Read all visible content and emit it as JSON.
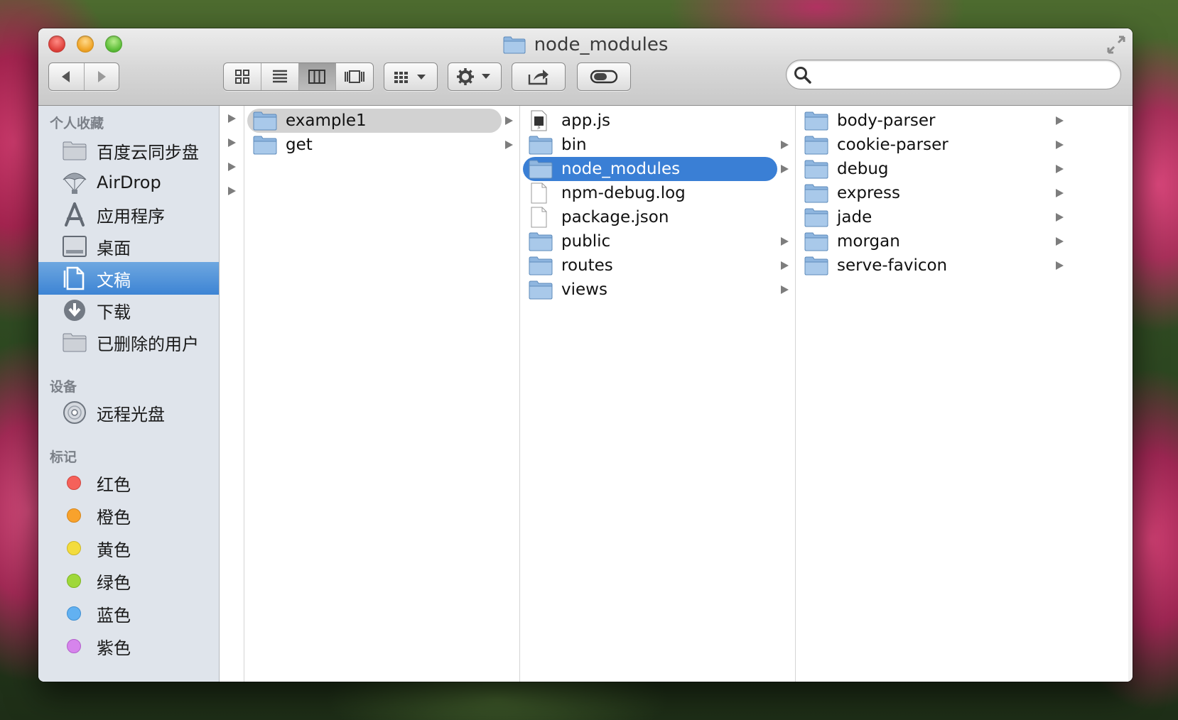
{
  "window": {
    "title": "node_modules"
  },
  "toolbar": {
    "nav": {
      "back": "back-arrow",
      "forward": "forward-arrow"
    },
    "view_modes": [
      "icon-view",
      "list-view",
      "column-view",
      "cover-flow-view"
    ],
    "active_view": "column-view",
    "arrange": "arrange-grid",
    "action": "gear",
    "share": "share",
    "tags": "toggle",
    "search": {
      "value": "",
      "placeholder": ""
    }
  },
  "sidebar": {
    "favorites_header": "个人收藏",
    "favorites": [
      {
        "label": "百度云同步盘",
        "icon": "folder-icon"
      },
      {
        "label": "AirDrop",
        "icon": "airdrop-icon"
      },
      {
        "label": "应用程序",
        "icon": "applications-icon"
      },
      {
        "label": "桌面",
        "icon": "desktop-icon"
      },
      {
        "label": "文稿",
        "icon": "documents-icon",
        "selected": true
      },
      {
        "label": "下载",
        "icon": "downloads-icon"
      },
      {
        "label": "已删除的用户",
        "icon": "folder-icon"
      }
    ],
    "devices_header": "设备",
    "devices": [
      {
        "label": "远程光盘",
        "icon": "disc-icon"
      }
    ],
    "tags_header": "标记",
    "tags": [
      {
        "label": "红色",
        "color": "#f5615a"
      },
      {
        "label": "橙色",
        "color": "#f8a22c"
      },
      {
        "label": "黄色",
        "color": "#f3dc3e"
      },
      {
        "label": "绿色",
        "color": "#9fd83a"
      },
      {
        "label": "蓝色",
        "color": "#62b1f1"
      },
      {
        "label": "紫色",
        "color": "#d684ec"
      }
    ]
  },
  "columns": {
    "col1": [
      {
        "name": "example1",
        "type": "folder",
        "selected": "grey"
      },
      {
        "name": "get",
        "type": "folder"
      }
    ],
    "col2": [
      {
        "name": "app.js",
        "type": "js"
      },
      {
        "name": "bin",
        "type": "folder"
      },
      {
        "name": "node_modules",
        "type": "folder",
        "selected": "blue"
      },
      {
        "name": "npm-debug.log",
        "type": "file"
      },
      {
        "name": "package.json",
        "type": "file"
      },
      {
        "name": "public",
        "type": "folder"
      },
      {
        "name": "routes",
        "type": "folder"
      },
      {
        "name": "views",
        "type": "folder"
      }
    ],
    "col3": [
      {
        "name": "body-parser",
        "type": "folder"
      },
      {
        "name": "cookie-parser",
        "type": "folder"
      },
      {
        "name": "debug",
        "type": "folder"
      },
      {
        "name": "express",
        "type": "folder"
      },
      {
        "name": "jade",
        "type": "folder"
      },
      {
        "name": "morgan",
        "type": "folder"
      },
      {
        "name": "serve-favicon",
        "type": "folder"
      }
    ]
  }
}
